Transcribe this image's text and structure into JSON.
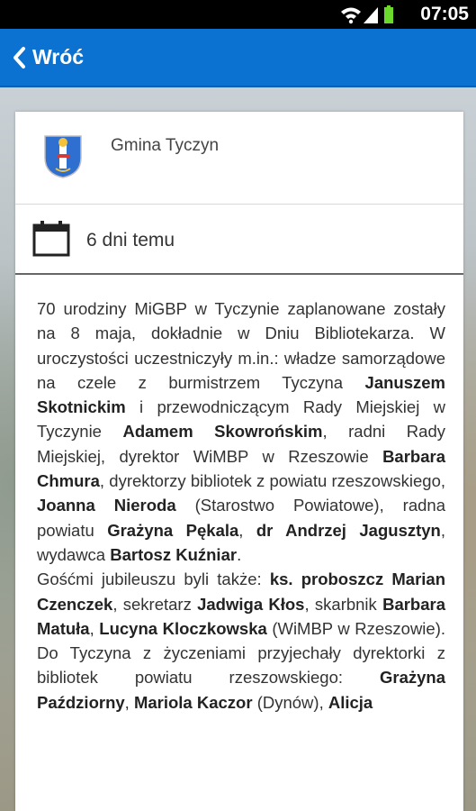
{
  "status_bar": {
    "time": "07:05",
    "icons": [
      "wifi-icon",
      "signal-icon",
      "battery-icon"
    ]
  },
  "action_bar": {
    "back_label": "Wróć",
    "color": "#0c72d2"
  },
  "post": {
    "author": "Gmina Tyczyn",
    "author_icon": "coat-of-arms-icon",
    "date": "6 dni temu",
    "date_icon": "calendar-icon",
    "body": [
      {
        "t": "70 urodziny MiGBP w Tyczynie zaplanowane zostały na 8 maja, dokładnie w Dniu Bibliotekarza. W uroczystości uczestniczyły m.in.: władze samorządowe na czele z burmistrzem Tyczyna ",
        "b": false
      },
      {
        "t": "Januszem Skotnickim",
        "b": true
      },
      {
        "t": " i przewodniczącym Rady Miejskiej w Tyczynie ",
        "b": false
      },
      {
        "t": "Adamem Skowrońskim",
        "b": true
      },
      {
        "t": ", radni Rady Miejskiej, dyrektor WiMBP w Rzeszowie ",
        "b": false
      },
      {
        "t": "Barbara Chmura",
        "b": true
      },
      {
        "t": ", dyrektorzy bibliotek z powiatu rzeszowskiego, ",
        "b": false
      },
      {
        "t": "Joanna Nieroda",
        "b": true
      },
      {
        "t": " (Starostwo Powiatowe), radna powiatu ",
        "b": false
      },
      {
        "t": "Grażyna Pękala",
        "b": true
      },
      {
        "t": ", ",
        "b": false
      },
      {
        "t": "dr Andrzej Jagusztyn",
        "b": true
      },
      {
        "t": ", wydawca ",
        "b": false
      },
      {
        "t": "Bartosz Kuźniar",
        "b": true
      },
      {
        "t": ".",
        "b": false
      },
      {
        "br": true
      },
      {
        "t": "Gośćmi jubileuszu byli także: ",
        "b": false
      },
      {
        "t": "ks. proboszcz Marian Czenczek",
        "b": true
      },
      {
        "t": ", sekretarz ",
        "b": false
      },
      {
        "t": "Jadwiga Kłos",
        "b": true
      },
      {
        "t": ", skarbnik ",
        "b": false
      },
      {
        "t": "Barbara Matuła",
        "b": true
      },
      {
        "t": ", ",
        "b": false
      },
      {
        "t": "Lucyna Kloczkowska",
        "b": true
      },
      {
        "t": " (WiMBP w Rzeszowie). Do Tyczyna z życzeniami przyjechały dyrektorki z bibliotek powiatu rzeszowskiego: ",
        "b": false
      },
      {
        "t": "Grażyna Paździorny",
        "b": true
      },
      {
        "t": ", ",
        "b": false
      },
      {
        "t": "Mariola Kaczor",
        "b": true
      },
      {
        "t": " (Dynów), ",
        "b": false
      },
      {
        "t": "Alicja",
        "b": true
      }
    ]
  }
}
